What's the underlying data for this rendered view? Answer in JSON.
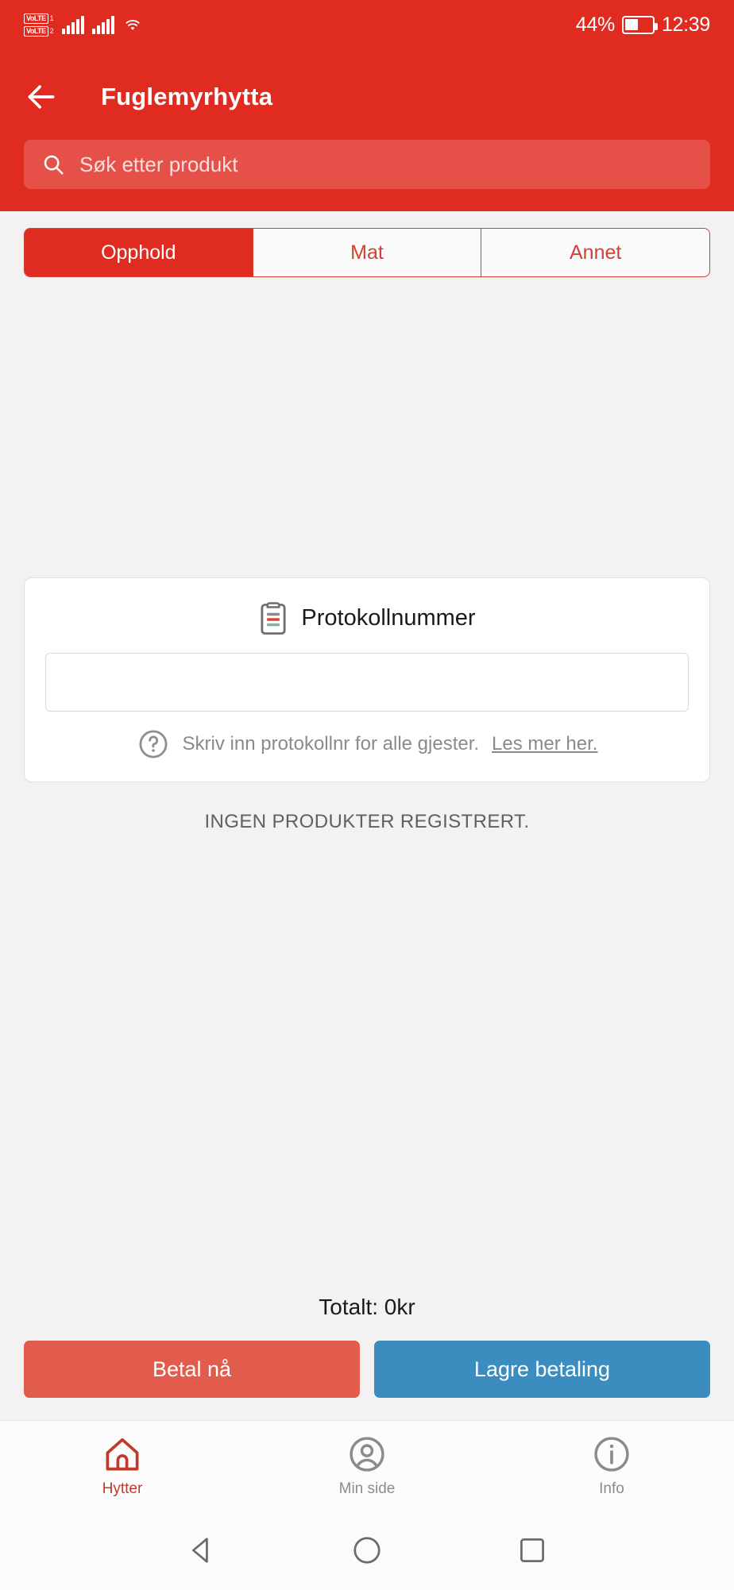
{
  "statusbar": {
    "volte_label_1": "VoLTE",
    "volte_sim_1": "1",
    "volte_label_2": "VoLTE",
    "volte_sim_2": "2",
    "battery_percent": "44%",
    "clock": "12:39",
    "icons": [
      "volte-icon",
      "signal-bars-icon",
      "signal-bars-icon",
      "wifi-icon",
      "battery-icon"
    ]
  },
  "appbar": {
    "back_icon": "back-arrow-icon",
    "title": "Fuglemyrhytta",
    "accent_color": "#e02b20"
  },
  "search": {
    "icon": "search-icon",
    "placeholder": "Søk etter produkt",
    "value": ""
  },
  "tabs": [
    {
      "label": "Opphold",
      "active": true
    },
    {
      "label": "Mat",
      "active": false
    },
    {
      "label": "Annet",
      "active": false
    }
  ],
  "protocol_card": {
    "icon": "clipboard-icon",
    "title": "Protokollnummer",
    "input_value": "",
    "input_placeholder": "",
    "help_icon": "question-mark-icon",
    "help_text": "Skriv inn protokollnr for alle gjester.",
    "help_link": "Les mer her."
  },
  "empty_state": {
    "message": "INGEN PRODUKTER REGISTRERT."
  },
  "footer": {
    "total_label": "Totalt: 0kr",
    "pay_button": "Betal nå",
    "save_button": "Lagre betaling",
    "pay_color": "#e25c4e",
    "save_color": "#3a8dbe"
  },
  "bottom_nav": [
    {
      "label": "Hytter",
      "icon": "home-icon",
      "active": true
    },
    {
      "label": "Min side",
      "icon": "person-icon",
      "active": false
    },
    {
      "label": "Info",
      "icon": "info-icon",
      "active": false
    }
  ],
  "system_nav": {
    "back": "triangle-back-icon",
    "home": "circle-home-icon",
    "recents": "square-recents-icon"
  }
}
